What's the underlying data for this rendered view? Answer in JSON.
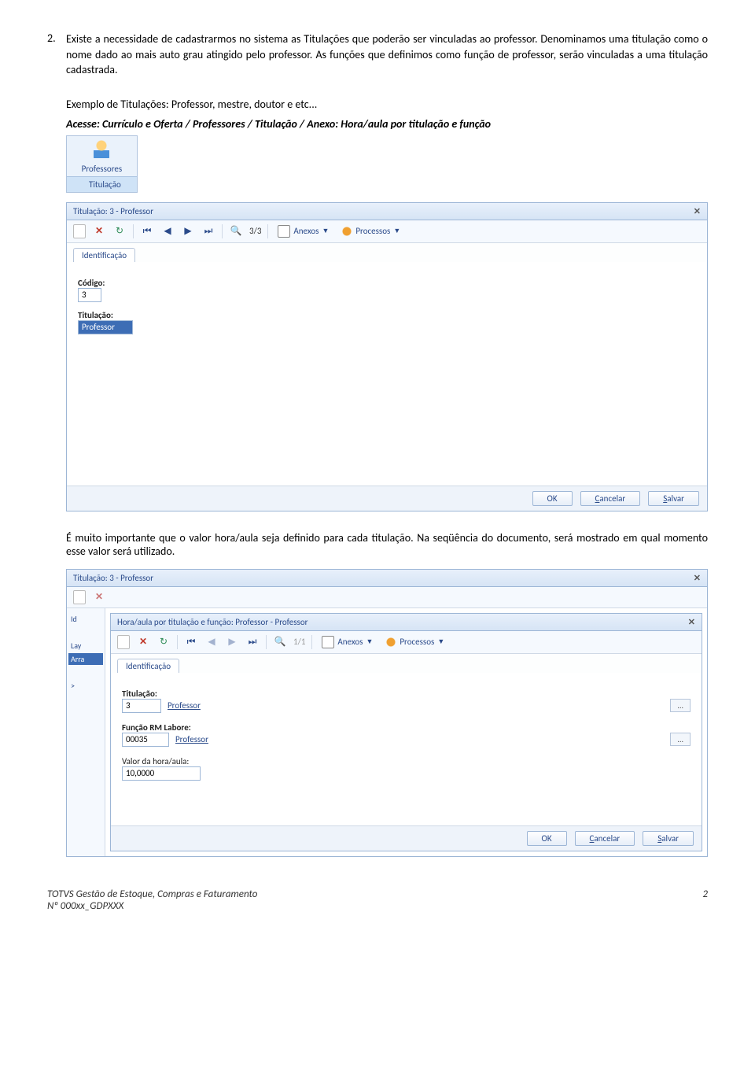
{
  "item": {
    "number": "2.",
    "para": "Existe a necessidade de cadastrarmos no sistema as Titulações que poderão ser vinculadas ao professor. Denominamos uma titulação como o nome dado ao mais auto grau atingido pelo professor. As funções que definimos como função de professor, serão vinculadas a uma titulação cadastrada."
  },
  "example_line": "Exemplo de Titulações: Professor, mestre, doutor e etc...",
  "access_line": "Acesse: Currículo e Oferta / Professores / Titulação / Anexo: Hora/aula por titulação e função",
  "menu": {
    "professores": "Professores",
    "titulacao": "Titulação"
  },
  "dialog1": {
    "title": "Titulação: 3 - Professor",
    "pager": "3/3",
    "anexos": "Anexos",
    "processos": "Processos",
    "tab": "Identificação",
    "codigo_label": "Código:",
    "codigo_value": "3",
    "titulacao_label": "Titulação:",
    "titulacao_value": "Professor",
    "ok": "OK",
    "cancel": "Cancelar",
    "save": "Salvar",
    "cancel_ul": "C",
    "save_ul": "S"
  },
  "note_para": "É muito importante que o valor hora/aula seja definido para cada titulação. Na seqüência do documento, será mostrado em qual momento esse valor será utilizado.",
  "outer": {
    "title": "Titulação: 3 - Professor",
    "side": {
      "id": "Id",
      "lay": "Lay",
      "arra": "Arra",
      "arrow": ">"
    }
  },
  "dialog2": {
    "title": "Hora/aula por titulação e função: Professor - Professor",
    "pager": "1/1",
    "anexos": "Anexos",
    "processos": "Processos",
    "tab": "Identificação",
    "titulacao_label": "Titulação:",
    "titulacao_code": "3",
    "titulacao_name": "Professor",
    "funcao_label": "Função RM Labore:",
    "funcao_code": "00035",
    "funcao_name": "Professor",
    "valor_label": "Valor da hora/aula:",
    "valor_value": "10,0000",
    "ok": "OK",
    "cancel": "Cancelar",
    "save": "Salvar"
  },
  "footer": {
    "left": "TOTVS Gestão de Estoque, Compras e Faturamento",
    "left2": "Nº 000xx_GDPXXX",
    "right": "2"
  }
}
